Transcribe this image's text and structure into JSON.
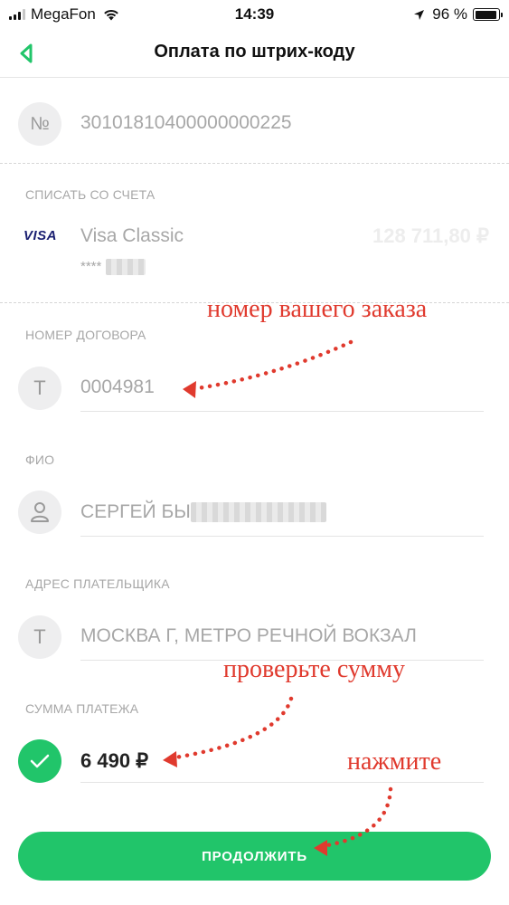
{
  "status_bar": {
    "carrier": "MegaFon",
    "time": "14:39",
    "battery": "96 %",
    "battery_level": 0.96
  },
  "nav": {
    "title": "Оплата по штрих-коду",
    "back_icon": "chevron-left-icon"
  },
  "barcode": {
    "icon_label": "№",
    "value": "30101810400000000225"
  },
  "account": {
    "label": "СПИСАТЬ СО СЧЕТА",
    "card_brand": "VISA",
    "card_name": "Visa Classic",
    "card_mask": "****",
    "balance": "128 711,80 ₽"
  },
  "contract": {
    "label": "НОМЕР ДОГОВОРА",
    "icon_label": "Т",
    "value": "0004981"
  },
  "fio": {
    "label": "ФИО",
    "icon": "person-icon",
    "value": "СЕРГЕЙ БЫ"
  },
  "address": {
    "label": "АДРЕС ПЛАТЕЛЬЩИКА",
    "icon_label": "Т",
    "value": "МОСКВА Г, МЕТРО РЕЧНОЙ ВОКЗАЛ"
  },
  "amount": {
    "label": "СУММА ПЛАТЕЖА",
    "icon": "check-icon",
    "value": "6 490 ₽"
  },
  "continue_button": {
    "label": "ПРОДОЛЖИТЬ"
  },
  "annotations": {
    "order_number": "номер вашего заказа",
    "check_amount": "проверьте сумму",
    "press": "нажмите"
  },
  "colors": {
    "accent": "#21c56a",
    "annotation": "#e03a2e",
    "muted_text": "#a7a7a7"
  }
}
